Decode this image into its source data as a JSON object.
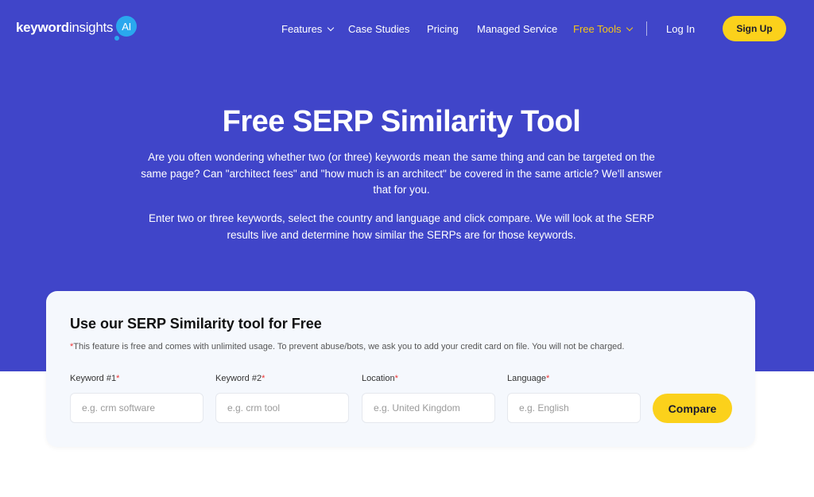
{
  "brand": {
    "logo_bold": "keyword",
    "logo_light": "insights",
    "logo_badge": "AI"
  },
  "nav": {
    "items": [
      {
        "label": "Features",
        "has_dropdown": true
      },
      {
        "label": "Case Studies",
        "has_dropdown": false
      },
      {
        "label": "Pricing",
        "has_dropdown": false
      },
      {
        "label": "Managed Service",
        "has_dropdown": false
      },
      {
        "label": "Free Tools",
        "has_dropdown": true,
        "active": true
      }
    ],
    "login_label": "Log In",
    "signup_label": "Sign Up"
  },
  "hero": {
    "title": "Free SERP Similarity Tool",
    "paragraph1": "Are you often wondering whether two (or three) keywords mean the same thing and can be targeted on the same page? Can \"architect fees\" and \"how much is an architect\" be covered in the same article? We'll answer that for you.",
    "paragraph2": "Enter two or three keywords, select the country and language and click compare. We will look at the SERP results live and determine how similar the SERPs are for those keywords."
  },
  "form": {
    "title": "Use our SERP Similarity tool for Free",
    "note_asterisk": "*",
    "note": "This feature is free and comes with unlimited usage. To prevent abuse/bots, we ask you to add your credit card on file. You will not be charged.",
    "fields": [
      {
        "label": "Keyword #1",
        "required_mark": "*",
        "placeholder": "e.g. crm software",
        "value": ""
      },
      {
        "label": "Keyword #2",
        "required_mark": "*",
        "placeholder": "e.g. crm tool",
        "value": ""
      },
      {
        "label": "Location",
        "required_mark": "*",
        "placeholder": "e.g. United Kingdom",
        "value": ""
      },
      {
        "label": "Language",
        "required_mark": "*",
        "placeholder": "e.g. English",
        "value": ""
      }
    ],
    "submit_label": "Compare"
  },
  "colors": {
    "hero_background": "#4045c9",
    "accent_yellow": "#fbd11b",
    "active_nav": "#f5c518",
    "ai_badge": "#2aa8ee",
    "required_mark": "#e33333"
  }
}
